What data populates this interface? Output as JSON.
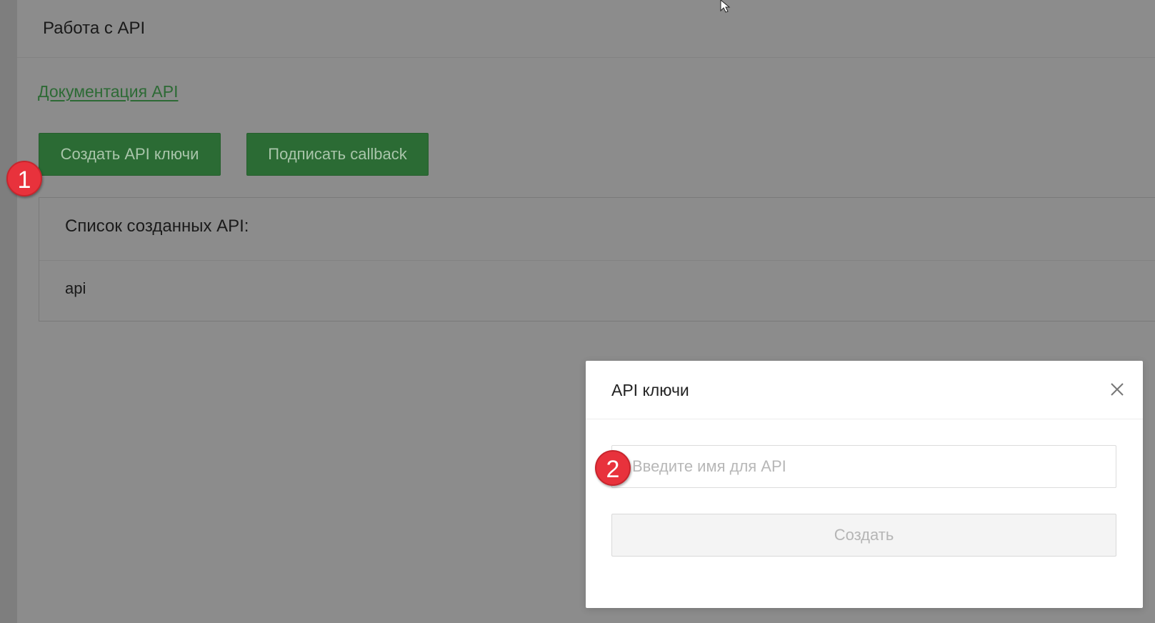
{
  "page": {
    "title": "Работа с API",
    "docs_link": "Документация API",
    "buttons": {
      "create_api_keys": "Создать API ключи",
      "subscribe_callback": "Подписать callback"
    },
    "api_list": {
      "title": "Список созданных API:",
      "items": [
        "api"
      ]
    }
  },
  "modal": {
    "title": "API ключи",
    "close_icon": "close-icon",
    "input_placeholder": "Введите имя для API",
    "input_value": "",
    "submit_label": "Создать"
  },
  "annotations": {
    "badge_1": "1",
    "badge_2": "2"
  },
  "colors": {
    "overlay": "#8c8c8c",
    "button_green": "#2b6b34",
    "link_green": "#2d6a35",
    "badge_red": "#e8323c"
  }
}
